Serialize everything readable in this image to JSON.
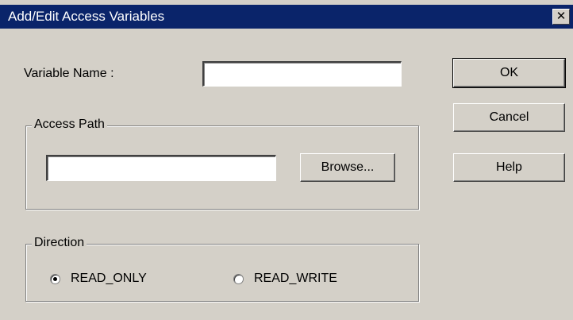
{
  "window": {
    "title": "Add/Edit Access Variables",
    "close_glyph": "✕"
  },
  "variable_name": {
    "label": "Variable Name :",
    "value": ""
  },
  "access_path": {
    "group_label": "Access Path",
    "value": "",
    "browse_label": "Browse..."
  },
  "direction": {
    "group_label": "Direction",
    "options": [
      {
        "label": "READ_ONLY",
        "selected": true
      },
      {
        "label": "READ_WRITE",
        "selected": false
      }
    ]
  },
  "buttons": {
    "ok": "OK",
    "cancel": "Cancel",
    "help": "Help"
  },
  "colors": {
    "titlebar": "#0a246a",
    "dialog_face": "#d4d0c8"
  }
}
